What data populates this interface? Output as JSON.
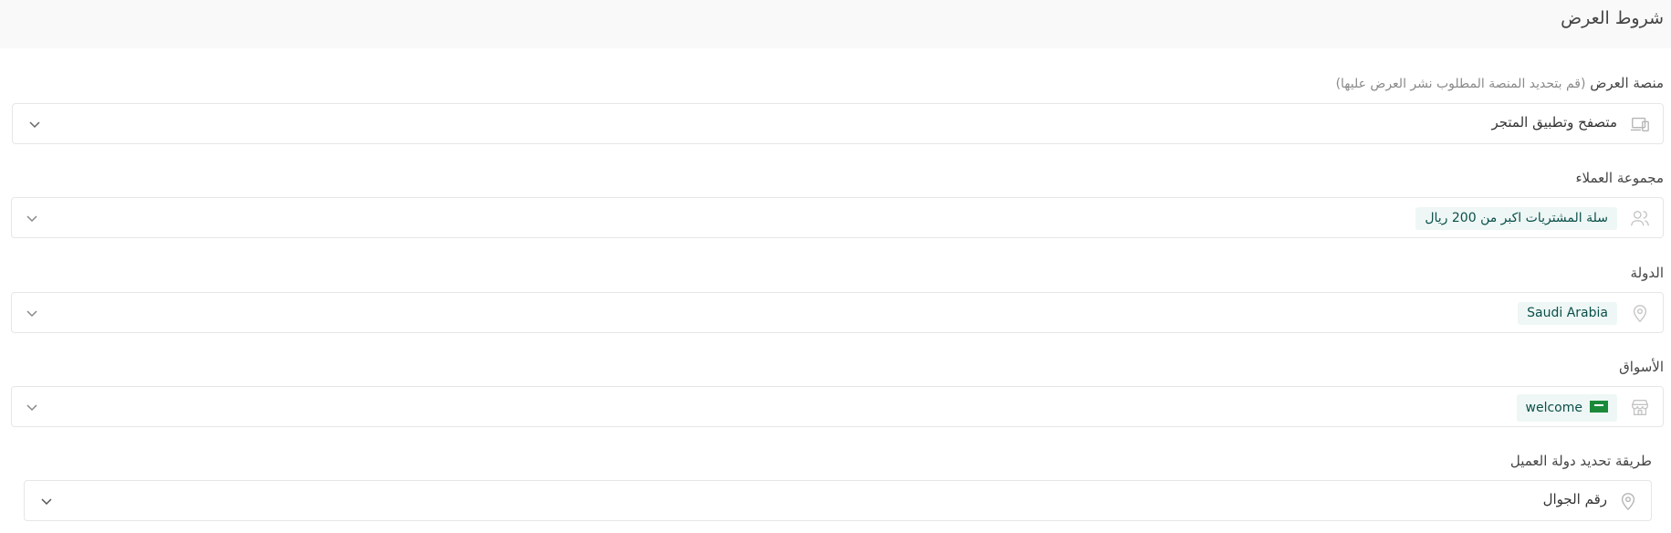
{
  "header": {
    "title": "شروط العرض"
  },
  "fields": {
    "platform": {
      "label": "منصة العرض",
      "hint": "(قم بتحديد المنصة المطلوب نشر العرض عليها)",
      "value": "متصفح وتطبيق المتجر",
      "icon": "devices-icon"
    },
    "customer_group": {
      "label": "مجموعة العملاء",
      "chip": "سلة المشتريات اكبر من 200 ريال",
      "icon": "users-icon"
    },
    "country": {
      "label": "الدولة",
      "chip": "Saudi Arabia",
      "icon": "location-icon"
    },
    "markets": {
      "label": "الأسواق",
      "chip": "welcome",
      "icon": "store-icon"
    },
    "country_detection": {
      "label": "طريقة تحديد دولة العميل",
      "value": "رقم الجوال",
      "icon": "location-icon"
    }
  },
  "colors": {
    "chip_bg": "#eef7f5",
    "chip_text": "#0a4f4a",
    "border": "#e6e6e6",
    "header_bg": "#f9f9f9"
  }
}
